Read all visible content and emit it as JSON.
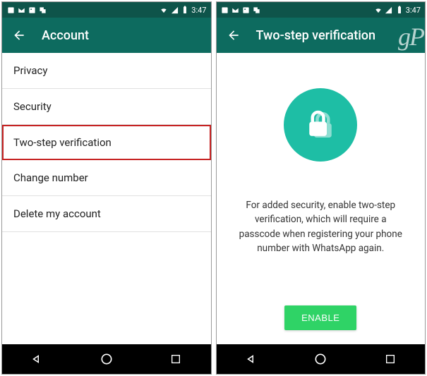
{
  "status": {
    "time": "3:47"
  },
  "left": {
    "title": "Account",
    "items": [
      "Privacy",
      "Security",
      "Two-step verification",
      "Change number",
      "Delete my account"
    ],
    "highlighted_index": 2
  },
  "right": {
    "title": "Two-step verification",
    "watermark": "gP",
    "description": "For added security, enable two-step verification, which will require a passcode when registering your phone number with WhatsApp again.",
    "button": "ENABLE"
  },
  "colors": {
    "statusbar": "#0e544a",
    "appbar": "#0d6b5f",
    "accent": "#1ebea5",
    "enable": "#2fd366",
    "highlight": "#c62121"
  }
}
